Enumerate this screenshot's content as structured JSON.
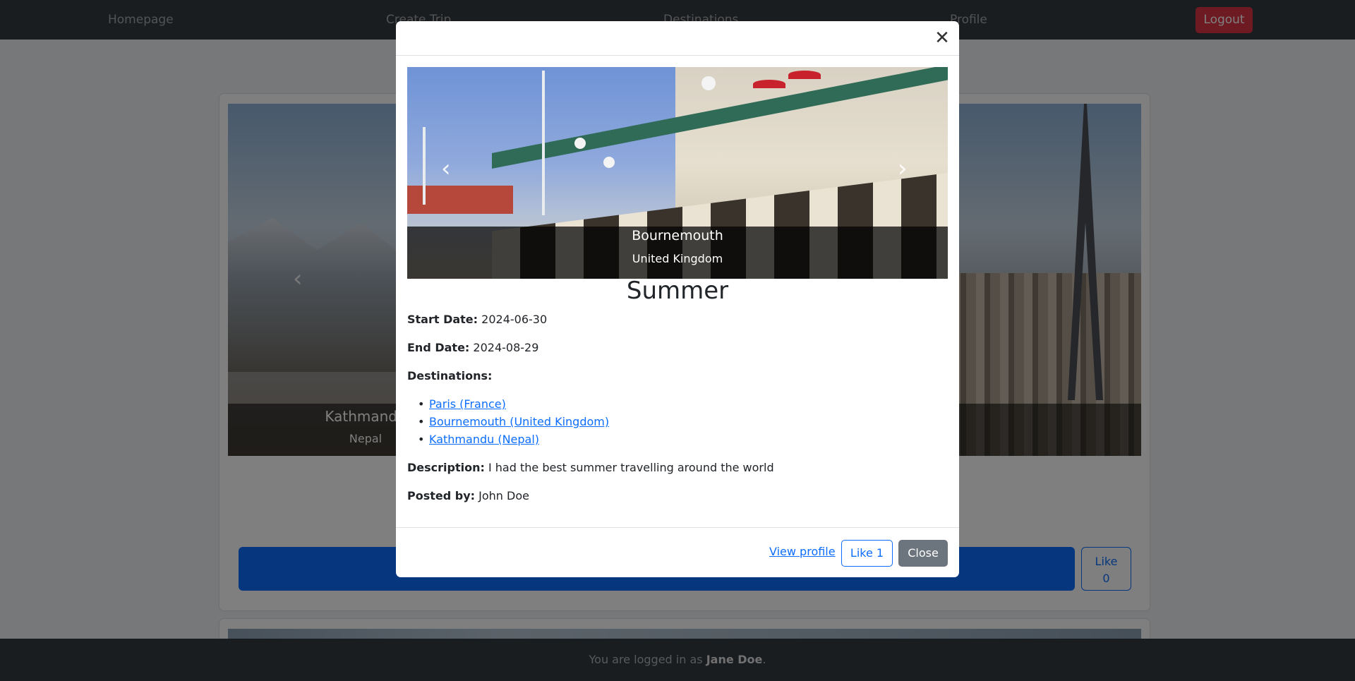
{
  "navbar": {
    "links": [
      "Homepage",
      "Create Trip",
      "Destinations",
      "Profile"
    ],
    "logout_label": "Logout"
  },
  "background": {
    "carousel_caption": {
      "title": "Kathmandu",
      "subtitle": "Nepal"
    },
    "like_label": "Like",
    "like_count": "0"
  },
  "modal": {
    "close_icon": "close-icon",
    "carousel": {
      "title": "Bournemouth",
      "subtitle": "United Kingdom"
    },
    "trip_title": "Summer",
    "start_date_label": "Start Date:",
    "start_date": "2024-06-30",
    "end_date_label": "End Date:",
    "end_date": "2024-08-29",
    "destinations_label": "Destinations:",
    "destinations": [
      "Paris (France)",
      "Bournemouth (United Kingdom)",
      "Kathmandu (Nepal)"
    ],
    "description_label": "Description:",
    "description": "I had the best summer travelling around the world",
    "posted_by_label": "Posted by:",
    "posted_by": "John Doe",
    "view_profile_label": "View profile",
    "like_label": "Like 1",
    "close_label": "Close"
  },
  "footer": {
    "prefix": "You are logged in as",
    "user": "Jane Doe",
    "suffix": "."
  },
  "colors": {
    "primary": "#0d6efd",
    "danger": "#dc3545",
    "secondary": "#6c757d",
    "navbar": "#343a40"
  }
}
